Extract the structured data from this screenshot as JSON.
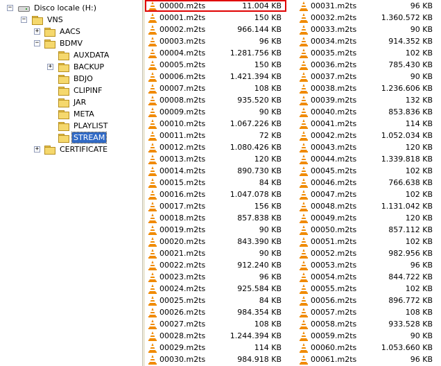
{
  "tree": {
    "drive": "Disco locale (H:)",
    "vns": "VNS",
    "aacs": "AACS",
    "bdmv": "BDMV",
    "auxdata": "AUXDATA",
    "backup": "BACKUP",
    "bdjo": "BDJO",
    "clipinf": "CLIPINF",
    "jar": "JAR",
    "meta": "META",
    "playlist": "PLAYLIST",
    "stream": "STREAM",
    "certificate": "CERTIFICATE",
    "plus": "+",
    "minus": "−"
  },
  "files": {
    "col1": [
      {
        "name": "00000.m2ts",
        "size": "11.004 KB"
      },
      {
        "name": "00001.m2ts",
        "size": "150 KB"
      },
      {
        "name": "00002.m2ts",
        "size": "966.144 KB"
      },
      {
        "name": "00003.m2ts",
        "size": "96 KB"
      },
      {
        "name": "00004.m2ts",
        "size": "1.281.756 KB"
      },
      {
        "name": "00005.m2ts",
        "size": "150 KB"
      },
      {
        "name": "00006.m2ts",
        "size": "1.421.394 KB"
      },
      {
        "name": "00007.m2ts",
        "size": "108 KB"
      },
      {
        "name": "00008.m2ts",
        "size": "935.520 KB"
      },
      {
        "name": "00009.m2ts",
        "size": "90 KB"
      },
      {
        "name": "00010.m2ts",
        "size": "1.067.226 KB"
      },
      {
        "name": "00011.m2ts",
        "size": "72 KB"
      },
      {
        "name": "00012.m2ts",
        "size": "1.080.426 KB"
      },
      {
        "name": "00013.m2ts",
        "size": "120 KB"
      },
      {
        "name": "00014.m2ts",
        "size": "890.730 KB"
      },
      {
        "name": "00015.m2ts",
        "size": "84 KB"
      },
      {
        "name": "00016.m2ts",
        "size": "1.047.078 KB"
      },
      {
        "name": "00017.m2ts",
        "size": "156 KB"
      },
      {
        "name": "00018.m2ts",
        "size": "857.838 KB"
      },
      {
        "name": "00019.m2ts",
        "size": "90 KB"
      },
      {
        "name": "00020.m2ts",
        "size": "843.390 KB"
      },
      {
        "name": "00021.m2ts",
        "size": "90 KB"
      },
      {
        "name": "00022.m2ts",
        "size": "912.240 KB"
      },
      {
        "name": "00023.m2ts",
        "size": "96 KB"
      },
      {
        "name": "00024.m2ts",
        "size": "925.584 KB"
      },
      {
        "name": "00025.m2ts",
        "size": "84 KB"
      },
      {
        "name": "00026.m2ts",
        "size": "984.354 KB"
      },
      {
        "name": "00027.m2ts",
        "size": "108 KB"
      },
      {
        "name": "00028.m2ts",
        "size": "1.244.394 KB"
      },
      {
        "name": "00029.m2ts",
        "size": "114 KB"
      },
      {
        "name": "00030.m2ts",
        "size": "984.918 KB"
      }
    ],
    "col2": [
      {
        "name": "00031.m2ts",
        "size": "96 KB"
      },
      {
        "name": "00032.m2ts",
        "size": "1.360.572 KB"
      },
      {
        "name": "00033.m2ts",
        "size": "90 KB"
      },
      {
        "name": "00034.m2ts",
        "size": "914.352 KB"
      },
      {
        "name": "00035.m2ts",
        "size": "102 KB"
      },
      {
        "name": "00036.m2ts",
        "size": "785.430 KB"
      },
      {
        "name": "00037.m2ts",
        "size": "90 KB"
      },
      {
        "name": "00038.m2ts",
        "size": "1.236.606 KB"
      },
      {
        "name": "00039.m2ts",
        "size": "132 KB"
      },
      {
        "name": "00040.m2ts",
        "size": "853.836 KB"
      },
      {
        "name": "00041.m2ts",
        "size": "114 KB"
      },
      {
        "name": "00042.m2ts",
        "size": "1.052.034 KB"
      },
      {
        "name": "00043.m2ts",
        "size": "120 KB"
      },
      {
        "name": "00044.m2ts",
        "size": "1.339.818 KB"
      },
      {
        "name": "00045.m2ts",
        "size": "102 KB"
      },
      {
        "name": "00046.m2ts",
        "size": "766.638 KB"
      },
      {
        "name": "00047.m2ts",
        "size": "102 KB"
      },
      {
        "name": "00048.m2ts",
        "size": "1.131.042 KB"
      },
      {
        "name": "00049.m2ts",
        "size": "120 KB"
      },
      {
        "name": "00050.m2ts",
        "size": "857.112 KB"
      },
      {
        "name": "00051.m2ts",
        "size": "102 KB"
      },
      {
        "name": "00052.m2ts",
        "size": "982.956 KB"
      },
      {
        "name": "00053.m2ts",
        "size": "96 KB"
      },
      {
        "name": "00054.m2ts",
        "size": "844.722 KB"
      },
      {
        "name": "00055.m2ts",
        "size": "102 KB"
      },
      {
        "name": "00056.m2ts",
        "size": "896.772 KB"
      },
      {
        "name": "00057.m2ts",
        "size": "108 KB"
      },
      {
        "name": "00058.m2ts",
        "size": "933.528 KB"
      },
      {
        "name": "00059.m2ts",
        "size": "90 KB"
      },
      {
        "name": "00060.m2ts",
        "size": "1.053.660 KB"
      },
      {
        "name": "00061.m2ts",
        "size": "96 KB"
      }
    ]
  },
  "colors": {
    "highlight": "#e00000",
    "selection": "#316ac5",
    "file_icon": "#f08a00"
  }
}
